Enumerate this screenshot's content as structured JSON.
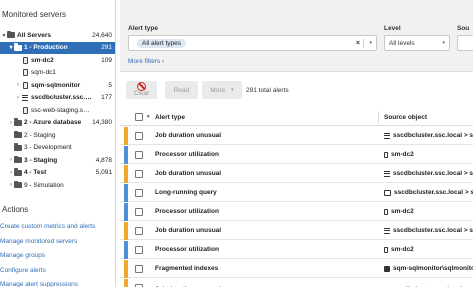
{
  "sidebar": {
    "heading": "Monitored servers",
    "tree": [
      {
        "label": "All Servers",
        "count": "24,640",
        "type": "folder",
        "chev": "▾",
        "indent": 0,
        "bold": true,
        "selected": false
      },
      {
        "label": "1 - Production",
        "count": "291",
        "type": "folder",
        "chev": "▾",
        "indent": 1,
        "bold": true,
        "selected": true
      },
      {
        "label": "sm-dc2",
        "count": "109",
        "type": "server",
        "chev": "",
        "indent": 2,
        "bold": true,
        "selected": false
      },
      {
        "label": "sqm-dc1",
        "count": "",
        "type": "server",
        "chev": "",
        "indent": 2,
        "bold": false,
        "selected": false
      },
      {
        "label": "sqm-sqlmonitor",
        "count": "5",
        "type": "server",
        "chev": "›",
        "indent": 2,
        "bold": true,
        "selected": false
      },
      {
        "label": "sscdbcluster.ssc.local",
        "count": "177",
        "type": "cluster",
        "chev": "›",
        "indent": 2,
        "bold": true,
        "selected": false
      },
      {
        "label": "ssc-web-staging.smdem...",
        "count": "",
        "type": "server",
        "chev": "",
        "indent": 2,
        "bold": false,
        "selected": false
      },
      {
        "label": "2 - Azure database",
        "count": "14,380",
        "type": "folder",
        "chev": "›",
        "indent": 1,
        "bold": true,
        "selected": false
      },
      {
        "label": "2 - Staging",
        "count": "",
        "type": "folder",
        "chev": "",
        "indent": 1,
        "bold": false,
        "selected": false
      },
      {
        "label": "3 - Development",
        "count": "",
        "type": "folder",
        "chev": "",
        "indent": 1,
        "bold": false,
        "selected": false
      },
      {
        "label": "3 - Staging",
        "count": "4,878",
        "type": "folder",
        "chev": "›",
        "indent": 1,
        "bold": true,
        "selected": false
      },
      {
        "label": "4 - Test",
        "count": "5,091",
        "type": "folder",
        "chev": "›",
        "indent": 1,
        "bold": true,
        "selected": false
      },
      {
        "label": "9 - Simulation",
        "count": "",
        "type": "folder",
        "chev": "›",
        "indent": 1,
        "bold": false,
        "selected": false
      }
    ],
    "actions_title": "Actions",
    "actions": [
      "Create custom metrics and alerts",
      "Manage monitored servers",
      "Manage groups",
      "Configure alerts",
      "Manage alert suppressions"
    ]
  },
  "filters": {
    "alert_type_label": "Alert type",
    "alert_type_chip": "All alert types",
    "clear_x": "×",
    "arrow": "▾",
    "level_label": "Level",
    "level_value": "All levels",
    "source_label": "Sou",
    "more_filters": "More filters",
    "more_filters_chev": "›"
  },
  "toolbar": {
    "clear": "Clear",
    "read": "Read",
    "more": "More",
    "more_arrow": "▾",
    "total": "291 total alerts"
  },
  "table": {
    "col_alert_type": "Alert type",
    "col_source": "Source object",
    "sort_arrow": "▾",
    "rows": [
      {
        "type": "Job duration unusual",
        "source": "sscdbcluster.ssc.local > ss",
        "icon": "cluster",
        "color": "#f2a82a"
      },
      {
        "type": "Processor utilization",
        "source": "sm-dc2",
        "icon": "server",
        "color": "#4f8fd6"
      },
      {
        "type": "Job duration unusual",
        "source": "sscdbcluster.ssc.local > ss",
        "icon": "cluster",
        "color": "#f2a82a"
      },
      {
        "type": "Long-running query",
        "source": "sscdbcluster.ssc.local > ss",
        "icon": "monitor",
        "color": "#4f8fd6"
      },
      {
        "type": "Processor utilization",
        "source": "sm-dc2",
        "icon": "server",
        "color": "#4f8fd6"
      },
      {
        "type": "Job duration unusual",
        "source": "sscdbcluster.ssc.local > ss",
        "icon": "cluster",
        "color": "#f2a82a"
      },
      {
        "type": "Processor utilization",
        "source": "sm-dc2",
        "icon": "server",
        "color": "#4f8fd6"
      },
      {
        "type": "Fragmented indexes",
        "source": "sqm-sqlmonitor\\sqlmonitor >",
        "icon": "sqm",
        "color": "#f2a82a"
      },
      {
        "type": "Job duration unusual",
        "source": "sscdbcluster.ssc.local > ss",
        "icon": "cluster",
        "color": "#f2a82a"
      }
    ]
  },
  "colors": {
    "accent": "#2f6fb7",
    "warning": "#f2a82a",
    "info": "#4f8fd6",
    "clear_icon": "#d42424"
  }
}
